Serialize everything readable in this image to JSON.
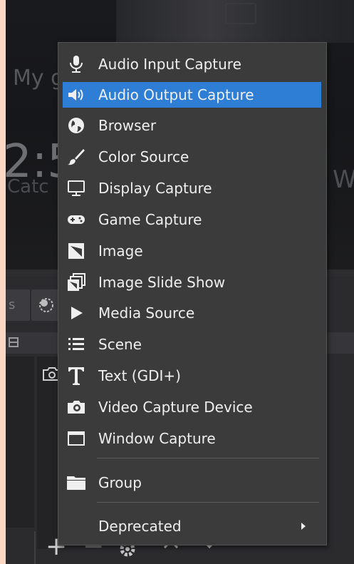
{
  "background_scene": {
    "line1": "My g",
    "time_fragment": "2:5",
    "line2": "Catc",
    "right_fragment": "W",
    "dock_tab_fragment": "s"
  },
  "context_menu": {
    "items": [
      {
        "label": "Audio Input Capture",
        "icon": "microphone-icon"
      },
      {
        "label": "Audio Output Capture",
        "icon": "speaker-icon",
        "highlighted": true
      },
      {
        "label": "Browser",
        "icon": "globe-icon"
      },
      {
        "label": "Color Source",
        "icon": "paintbrush-icon"
      },
      {
        "label": "Display Capture",
        "icon": "monitor-icon"
      },
      {
        "label": "Game Capture",
        "icon": "gamepad-icon"
      },
      {
        "label": "Image",
        "icon": "image-icon"
      },
      {
        "label": "Image Slide Show",
        "icon": "slideshow-icon"
      },
      {
        "label": "Media Source",
        "icon": "play-icon"
      },
      {
        "label": "Scene",
        "icon": "list-icon"
      },
      {
        "label": "Text (GDI+)",
        "icon": "text-icon"
      },
      {
        "label": "Video Capture Device",
        "icon": "camera-icon"
      },
      {
        "label": "Window Capture",
        "icon": "window-icon"
      }
    ],
    "group": {
      "label": "Group",
      "icon": "folder-icon"
    },
    "deprecated": {
      "label": "Deprecated",
      "has_submenu": true
    }
  },
  "toolbar": {
    "add_label": "+",
    "remove_label": "−"
  },
  "colors": {
    "menu_bg": "#3b3b3b",
    "highlight": "#2e7ed6",
    "text": "#efefef",
    "outer_bg": "#fcd8c4"
  }
}
